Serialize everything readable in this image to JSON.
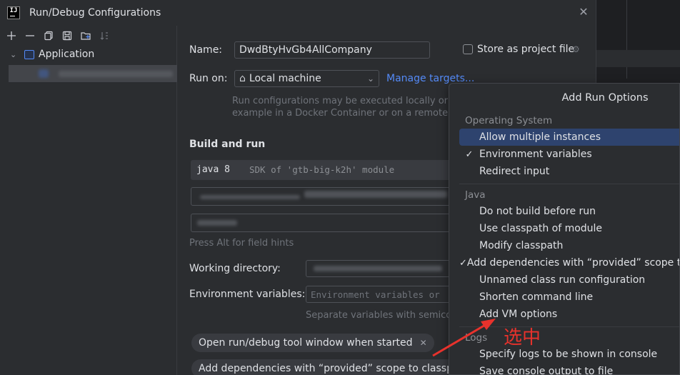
{
  "window": {
    "title": "Run/Debug Configurations",
    "logo_text": "IJ"
  },
  "left": {
    "toolbar": [
      "add-icon",
      "remove-icon",
      "copy-icon",
      "save-icon",
      "folder-icon",
      "sort-icon"
    ],
    "tree": {
      "root_label": "Application"
    }
  },
  "form": {
    "name_label": "Name:",
    "name_value": "DwdBtyHvGb4AllCompany",
    "store_label": "Store as project file",
    "run_on_label": "Run on:",
    "run_on_value": "Local machine",
    "manage_targets": "Manage targets...",
    "run_on_hint_1": "Run configurations may be executed locally or on",
    "run_on_hint_2": "example in a Docker Container or on a remote ho",
    "build_and_run": "Build and run",
    "sdk_main": "java 8",
    "sdk_detail": "SDK of 'gtb-big-k2h' module",
    "field_hints": "Press Alt for field hints",
    "working_dir_label": "Working directory:",
    "env_vars_label": "Environment variables:",
    "env_vars_placeholder": "Environment variables or",
    "env_vars_hint": "Separate variables with semicolo",
    "chip_1": "Open run/debug tool window when started",
    "chip_2": "Add dependencies with “provided” scope to classpat"
  },
  "popup": {
    "title": "Add Run Options",
    "group_os": "Operating System",
    "os_items": [
      {
        "label": "Allow multiple instances",
        "checked": false,
        "selected": true
      },
      {
        "label": "Environment variables",
        "checked": true,
        "selected": false
      },
      {
        "label": "Redirect input",
        "checked": false,
        "selected": false
      }
    ],
    "group_java": "Java",
    "java_items": [
      {
        "label": "Do not build before run",
        "checked": false
      },
      {
        "label": "Use classpath of module",
        "checked": false
      },
      {
        "label": "Modify classpath",
        "checked": false
      },
      {
        "label": "Add dependencies with “provided” scope to classpath",
        "checked": true
      },
      {
        "label": "Unnamed class run configuration",
        "checked": false
      },
      {
        "label": "Shorten command line",
        "checked": false
      },
      {
        "label": "Add VM options",
        "checked": false
      }
    ],
    "group_logs": "Logs",
    "logs_items": [
      {
        "label": "Specify logs to be shown in console",
        "checked": false
      },
      {
        "label": "Save console output to file",
        "checked": false
      }
    ]
  },
  "annotation": {
    "text": "选中",
    "color": "#e8322c"
  },
  "colors": {
    "accent": "#548af7",
    "selection": "#2e436e",
    "background": "#2b2d30"
  }
}
